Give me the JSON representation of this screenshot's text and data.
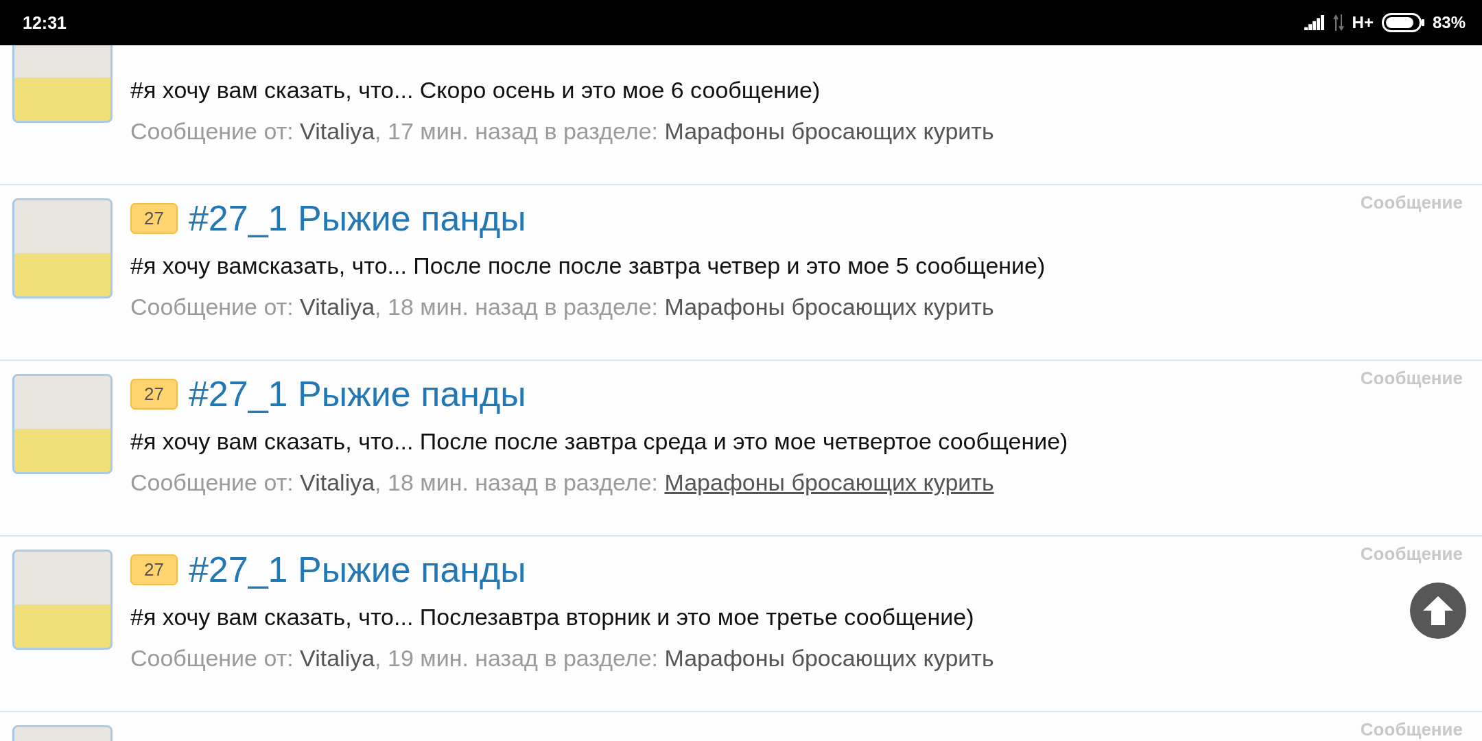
{
  "status_bar": {
    "time": "12:31",
    "network": "H+",
    "battery": "83%"
  },
  "posts": [
    {
      "message": "#я хочу вам сказать, что... Скоро осень и это мое 6 сообщение)",
      "meta": {
        "prefix": "Сообщение от:",
        "author": "Vitaliya",
        "time": ", 17 мин. назад в разделе:",
        "section": "Марафоны бросающих курить",
        "section_underlined": false
      }
    },
    {
      "badge": "27",
      "title": "#27_1 Рыжие панды",
      "type_label": "Сообщение",
      "message": "#я хочу вамсказать, что... После после после завтра четвер и это мое 5 сообщение)",
      "meta": {
        "prefix": "Сообщение от:",
        "author": "Vitaliya",
        "time": ", 18 мин. назад в разделе:",
        "section": "Марафоны бросающих курить",
        "section_underlined": false
      }
    },
    {
      "badge": "27",
      "title": "#27_1 Рыжие панды",
      "type_label": "Сообщение",
      "message": "#я хочу вам сказать, что... После после завтра среда и это мое четвертое сообщение)",
      "meta": {
        "prefix": "Сообщение от:",
        "author": "Vitaliya",
        "time": ", 18 мин. назад в разделе:",
        "section": "Марафоны бросающих курить",
        "section_underlined": true
      }
    },
    {
      "badge": "27",
      "title": "#27_1 Рыжие панды",
      "type_label": "Сообщение",
      "message": "#я хочу вам сказать, что... Послезавтра вторник и это мое третье сообщение)",
      "meta": {
        "prefix": "Сообщение от:",
        "author": "Vitaliya",
        "time": ", 19 мин. назад в разделе:",
        "section": "Марафоны бросающих курить",
        "section_underlined": false
      }
    },
    {
      "type_label": "Сообщение"
    }
  ]
}
